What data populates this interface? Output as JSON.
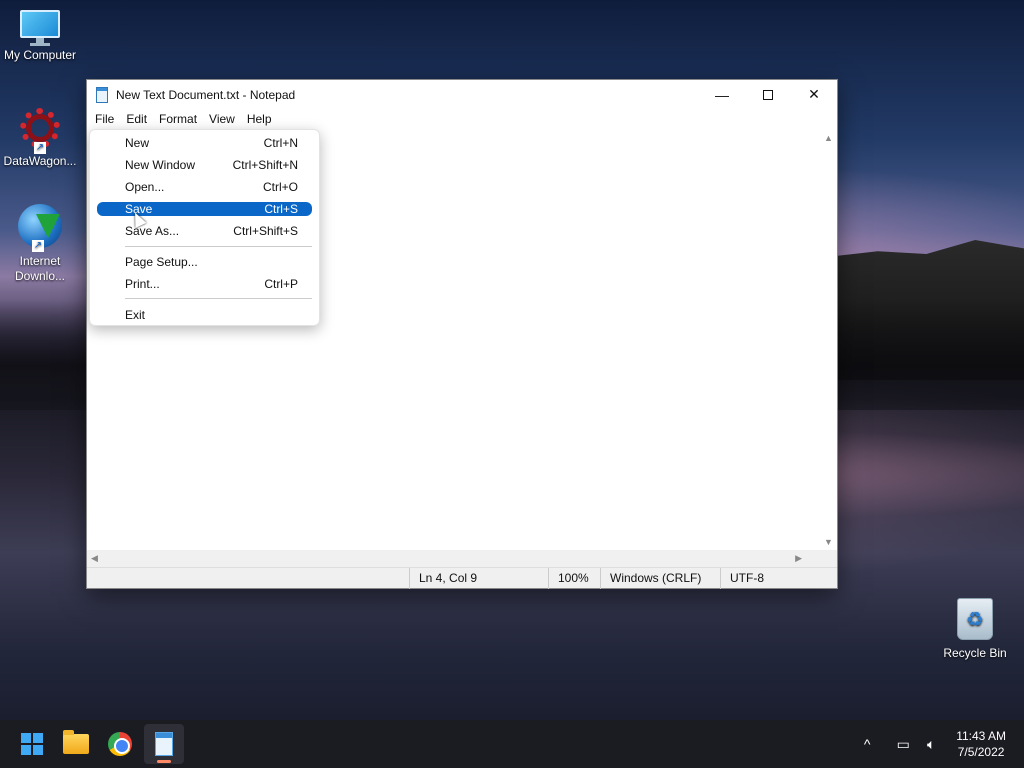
{
  "desktop": {
    "icons": [
      {
        "label": "My Computer"
      },
      {
        "label": "DataWagon..."
      },
      {
        "label": "Internet\nDownlo..."
      },
      {
        "label": "Recycle Bin"
      }
    ]
  },
  "window": {
    "title": "New Text Document.txt - Notepad",
    "controls": {
      "minimize": "—",
      "close": "✕"
    },
    "menu": [
      "File",
      "Edit",
      "Format",
      "View",
      "Help"
    ],
    "status": {
      "position": "Ln 4, Col 9",
      "zoom": "100%",
      "line_endings": "Windows (CRLF)",
      "encoding": "UTF-8"
    }
  },
  "file_menu": {
    "items": [
      {
        "label": "New",
        "shortcut": "Ctrl+N"
      },
      {
        "label": "New Window",
        "shortcut": "Ctrl+Shift+N"
      },
      {
        "label": "Open...",
        "shortcut": "Ctrl+O"
      },
      {
        "label": "Save",
        "shortcut": "Ctrl+S",
        "selected": true
      },
      {
        "label": "Save As...",
        "shortcut": "Ctrl+Shift+S"
      },
      {
        "label": "Page Setup...",
        "shortcut": ""
      },
      {
        "label": "Print...",
        "shortcut": "Ctrl+P"
      },
      {
        "label": "Exit",
        "shortcut": ""
      }
    ]
  },
  "taskbar": {
    "apps": [
      "start-icon",
      "file-explorer-icon",
      "chrome-icon",
      "notepad-icon"
    ],
    "tray": {
      "chevron": "^",
      "time": "11:43 AM",
      "date": "7/5/2022"
    }
  }
}
